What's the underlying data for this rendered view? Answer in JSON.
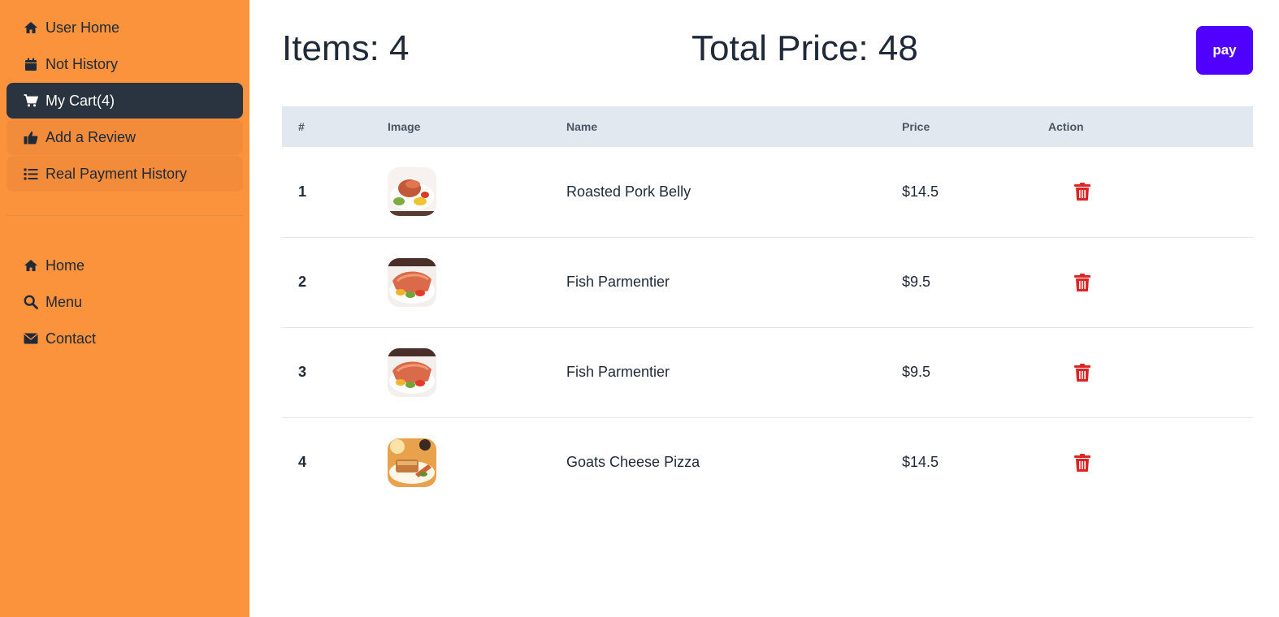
{
  "sidebar": {
    "top_items": [
      {
        "label": "User Home",
        "icon": "home-icon"
      },
      {
        "label": "Not History",
        "icon": "calendar-icon"
      },
      {
        "label": "My Cart(4)",
        "icon": "cart-icon"
      },
      {
        "label": "Add a Review",
        "icon": "thumbs-up-icon"
      },
      {
        "label": "Real Payment History",
        "icon": "list-icon"
      }
    ],
    "bottom_items": [
      {
        "label": "Home",
        "icon": "home-icon"
      },
      {
        "label": "Menu",
        "icon": "search-icon"
      },
      {
        "label": "Contact",
        "icon": "envelope-icon"
      }
    ]
  },
  "summary": {
    "items_text": "Items: 4",
    "total_text": "Total Price: 48",
    "pay_label": "pay"
  },
  "table": {
    "headers": [
      "#",
      "Image",
      "Name",
      "Price",
      "Action"
    ],
    "rows": [
      {
        "index": "1",
        "name": "Roasted Pork Belly",
        "price": "$14.5",
        "image": "roasted-pork-belly-thumbnail"
      },
      {
        "index": "2",
        "name": "Fish Parmentier",
        "price": "$9.5",
        "image": "fish-parmentier-thumbnail"
      },
      {
        "index": "3",
        "name": "Fish Parmentier",
        "price": "$9.5",
        "image": "fish-parmentier-thumbnail"
      },
      {
        "index": "4",
        "name": "Goats Cheese Pizza",
        "price": "$14.5",
        "image": "goats-cheese-pizza-thumbnail"
      }
    ]
  },
  "colors": {
    "sidebar_bg": "#fb923c",
    "active_nav_bg": "#2a3441",
    "pay_button": "#4f00ff",
    "delete_icon": "#dc2626",
    "table_header_bg": "#e2e8f0"
  }
}
